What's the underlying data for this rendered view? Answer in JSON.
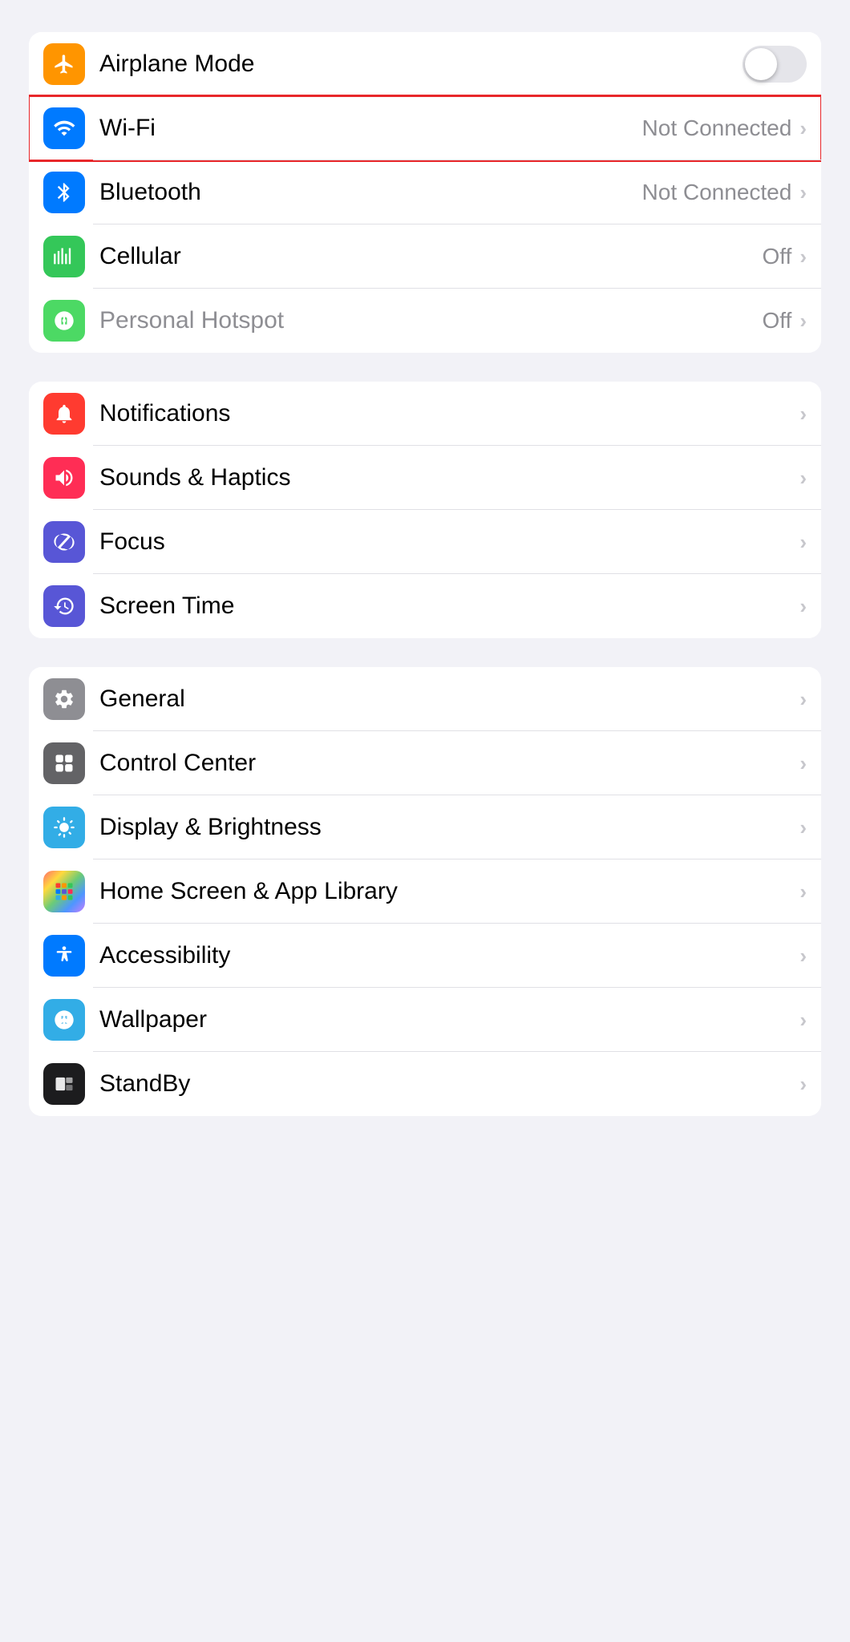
{
  "sections": [
    {
      "id": "connectivity",
      "rows": [
        {
          "id": "airplane-mode",
          "label": "Airplane Mode",
          "iconBg": "bg-orange",
          "iconType": "airplane",
          "rightType": "toggle",
          "toggleOn": false,
          "highlighted": false
        },
        {
          "id": "wifi",
          "label": "Wi-Fi",
          "iconBg": "bg-blue",
          "iconType": "wifi",
          "rightType": "chevron-value",
          "value": "Not Connected",
          "highlighted": true
        },
        {
          "id": "bluetooth",
          "label": "Bluetooth",
          "iconBg": "bg-blue-dark",
          "iconType": "bluetooth",
          "rightType": "chevron-value",
          "value": "Not Connected",
          "highlighted": false
        },
        {
          "id": "cellular",
          "label": "Cellular",
          "iconBg": "bg-green",
          "iconType": "cellular",
          "rightType": "chevron-value",
          "value": "Off",
          "highlighted": false
        },
        {
          "id": "personal-hotspot",
          "label": "Personal Hotspot",
          "labelDimmed": true,
          "iconBg": "bg-green-light",
          "iconType": "hotspot",
          "rightType": "chevron-value",
          "value": "Off",
          "highlighted": false
        }
      ]
    },
    {
      "id": "alerts",
      "rows": [
        {
          "id": "notifications",
          "label": "Notifications",
          "iconBg": "bg-red",
          "iconType": "notifications",
          "rightType": "chevron",
          "highlighted": false
        },
        {
          "id": "sounds-haptics",
          "label": "Sounds & Haptics",
          "iconBg": "bg-pink-red",
          "iconType": "sounds",
          "rightType": "chevron",
          "highlighted": false
        },
        {
          "id": "focus",
          "label": "Focus",
          "iconBg": "bg-indigo",
          "iconType": "focus",
          "rightType": "chevron",
          "highlighted": false
        },
        {
          "id": "screen-time",
          "label": "Screen Time",
          "iconBg": "bg-purple",
          "iconType": "screentime",
          "rightType": "chevron",
          "highlighted": false
        }
      ]
    },
    {
      "id": "general-settings",
      "rows": [
        {
          "id": "general",
          "label": "General",
          "iconBg": "bg-gray",
          "iconType": "general",
          "rightType": "chevron",
          "highlighted": false
        },
        {
          "id": "control-center",
          "label": "Control Center",
          "iconBg": "bg-gray2",
          "iconType": "control-center",
          "rightType": "chevron",
          "highlighted": false
        },
        {
          "id": "display-brightness",
          "label": "Display & Brightness",
          "iconBg": "bg-blue2",
          "iconType": "display",
          "rightType": "chevron",
          "highlighted": false
        },
        {
          "id": "home-screen",
          "label": "Home Screen & App Library",
          "iconBg": "bg-multicolor",
          "iconType": "homescreen",
          "rightType": "chevron",
          "highlighted": false
        },
        {
          "id": "accessibility",
          "label": "Accessibility",
          "iconBg": "bg-blue",
          "iconType": "accessibility",
          "rightType": "chevron",
          "highlighted": false
        },
        {
          "id": "wallpaper",
          "label": "Wallpaper",
          "iconBg": "bg-cyan",
          "iconType": "wallpaper",
          "rightType": "chevron",
          "highlighted": false
        },
        {
          "id": "standby",
          "label": "StandBy",
          "iconBg": "bg-black",
          "iconType": "standby",
          "rightType": "chevron",
          "highlighted": false
        }
      ]
    }
  ]
}
